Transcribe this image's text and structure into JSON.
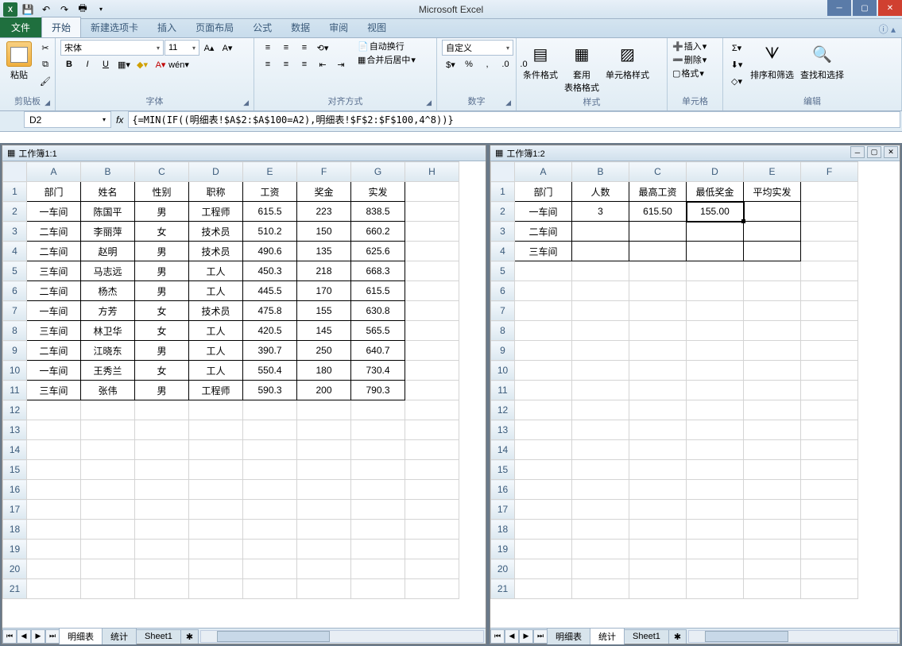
{
  "app": {
    "title": "Microsoft Excel"
  },
  "qat": {
    "save": "💾",
    "undo": "↶",
    "redo": "↷",
    "print": "🖶"
  },
  "tabs": {
    "file": "文件",
    "home": "开始",
    "newtab": "新建选项卡",
    "insert": "插入",
    "layout": "页面布局",
    "formulas": "公式",
    "data": "数据",
    "review": "审阅",
    "view": "视图"
  },
  "ribbon": {
    "clipboard": {
      "label": "剪贴板",
      "paste": "粘贴"
    },
    "font": {
      "label": "字体",
      "name": "宋体",
      "size": "11",
      "bold": "B",
      "italic": "I",
      "underline": "U"
    },
    "align": {
      "label": "对齐方式",
      "wrap": "自动换行",
      "merge": "合并后居中"
    },
    "number": {
      "label": "数字",
      "format": "自定义"
    },
    "styles": {
      "label": "样式",
      "cond": "条件格式",
      "table": "套用\n表格格式",
      "cell": "单元格样式"
    },
    "cells": {
      "label": "单元格",
      "insert": "插入",
      "delete": "删除",
      "format": "格式"
    },
    "editing": {
      "label": "编辑",
      "sort": "排序和筛选",
      "find": "查找和选择"
    }
  },
  "formula": {
    "cell": "D2",
    "value": "{=MIN(IF((明细表!$A$2:$A$100=A2),明细表!$F$2:$F$100,4^8))}"
  },
  "left": {
    "title": "工作簿1:1",
    "cols": [
      "A",
      "B",
      "C",
      "D",
      "E",
      "F",
      "G",
      "H"
    ],
    "header": [
      "部门",
      "姓名",
      "性别",
      "职称",
      "工资",
      "奖金",
      "实发"
    ],
    "rows": [
      [
        "一车间",
        "陈国平",
        "男",
        "工程师",
        "615.5",
        "223",
        "838.5"
      ],
      [
        "二车间",
        "李丽萍",
        "女",
        "技术员",
        "510.2",
        "150",
        "660.2"
      ],
      [
        "二车间",
        "赵明",
        "男",
        "技术员",
        "490.6",
        "135",
        "625.6"
      ],
      [
        "三车间",
        "马志远",
        "男",
        "工人",
        "450.3",
        "218",
        "668.3"
      ],
      [
        "二车间",
        "杨杰",
        "男",
        "工人",
        "445.5",
        "170",
        "615.5"
      ],
      [
        "一车间",
        "方芳",
        "女",
        "技术员",
        "475.8",
        "155",
        "630.8"
      ],
      [
        "三车间",
        "林卫华",
        "女",
        "工人",
        "420.5",
        "145",
        "565.5"
      ],
      [
        "二车间",
        "江晓东",
        "男",
        "工人",
        "390.7",
        "250",
        "640.7"
      ],
      [
        "一车间",
        "王秀兰",
        "女",
        "工人",
        "550.4",
        "180",
        "730.4"
      ],
      [
        "三车间",
        "张伟",
        "男",
        "工程师",
        "590.3",
        "200",
        "790.3"
      ]
    ],
    "tabs": [
      "明细表",
      "统计",
      "Sheet1"
    ]
  },
  "right": {
    "title": "工作簿1:2",
    "cols": [
      "A",
      "B",
      "C",
      "D",
      "E",
      "F"
    ],
    "header": [
      "部门",
      "人数",
      "最高工资",
      "最低奖金",
      "平均实发"
    ],
    "rows": [
      [
        "一车间",
        "3",
        "615.50",
        "155.00",
        ""
      ],
      [
        "二车间",
        "",
        "",
        "",
        ""
      ],
      [
        "三车间",
        "",
        "",
        "",
        ""
      ]
    ],
    "tabs": [
      "明细表",
      "统计",
      "Sheet1"
    ],
    "activeCell": "D2"
  }
}
